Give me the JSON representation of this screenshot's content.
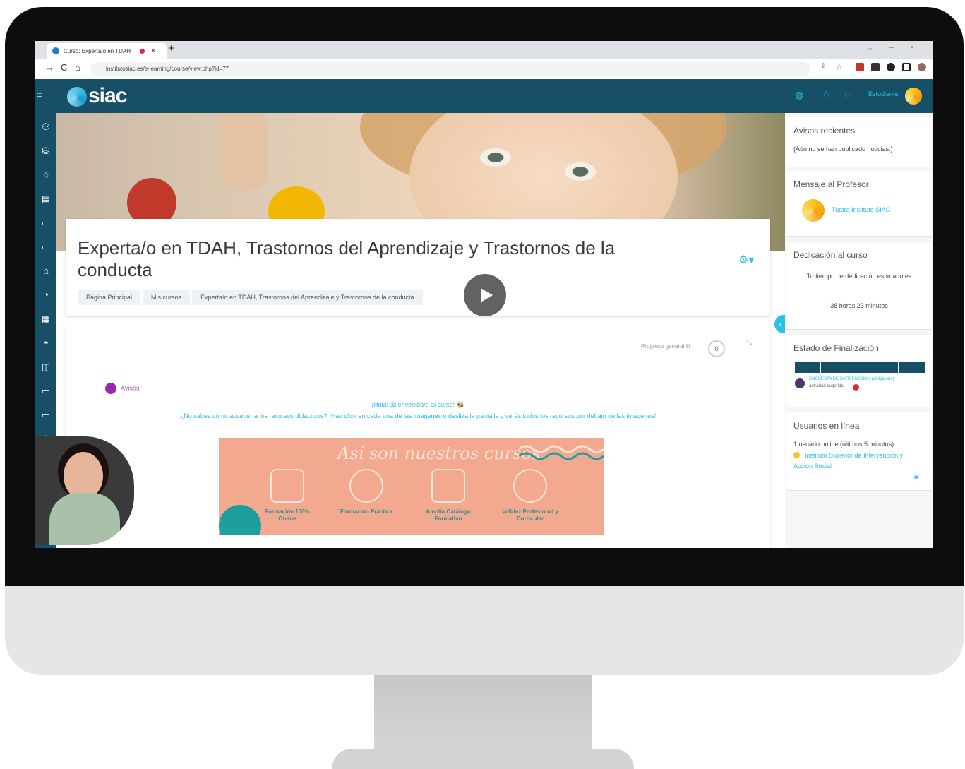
{
  "browser": {
    "tab_title": "Curso: Experta/o en TDAH",
    "tab_close": "×",
    "new_tab": "+",
    "url": "institutosiac.es/e-learning/course/view.php?id=77",
    "back": "←",
    "forward": "→",
    "reload": "C",
    "home": "⌂"
  },
  "header": {
    "logo": "siac",
    "user_label": "Estudiante"
  },
  "course": {
    "title": "Experta/o en TDAH, Trastornos del Aprendizaje y Trastornos de la conducta",
    "breadcrumbs": [
      "Página Principal",
      "Mis cursos",
      "Experta/o en TDAH, Trastornos del Aprendizaje y Trastornos de la conducta"
    ],
    "progress_label": "Progreso general %",
    "progress_value": "0",
    "avisos_label": "Avisos",
    "welcome": "¡Hola! ¡Bienvenida/o al curso! 🐝",
    "help": "¿No sabes cómo acceder a los recursos didácticos? ¡Haz click en cada una de las imágenes o desliza la pantalla y verás todos los recursos por debajo de las imágenes!"
  },
  "banner": {
    "script_title": "Así son nuestros cursos",
    "items": [
      {
        "label": "Formación 100% Online"
      },
      {
        "label": "Formación Práctica"
      },
      {
        "label": "Amplio Catálogo Formativo"
      },
      {
        "label": "Validez Profesional y Curricular"
      }
    ]
  },
  "blocks": {
    "avisos": {
      "title": "Avisos recientes",
      "text": "(Aún no se han publicado noticias.)"
    },
    "mensaje": {
      "title": "Mensaje al Profesor",
      "teacher": "Tutora Instituto SIAC"
    },
    "dedicacion": {
      "title": "Dedicación al curso",
      "text": "Tu tiempo de dedicación estimado es",
      "time": "38 horas 23 minutos"
    },
    "estado": {
      "title": "Estado de Finalización",
      "item": "ENCUESTA DE SATISFACCIÓN (obligatorio)",
      "status": "actividad-sugerida"
    },
    "usuarios": {
      "title": "Usuarios en línea",
      "count_text": "1 usuario online (últimos 5 minutos)",
      "user": "Instituto Superior de Intervención y Acción Social"
    }
  },
  "colors": {
    "header": "#164f66",
    "accent": "#29c1e8",
    "banner": "#f3a990"
  }
}
